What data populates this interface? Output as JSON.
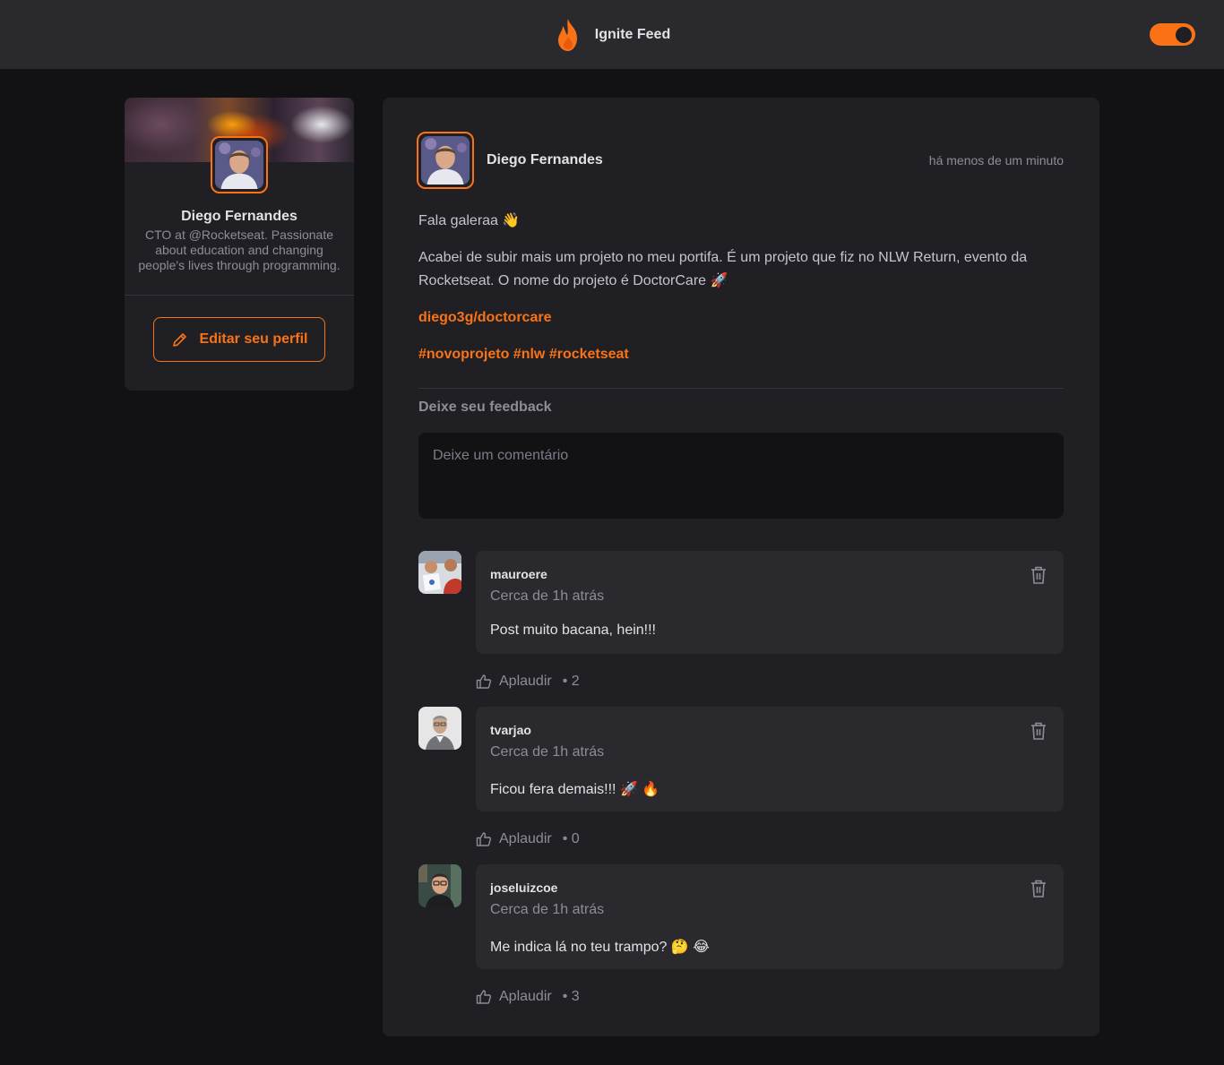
{
  "app": {
    "title": "Ignite Feed",
    "theme_toggle_on": true,
    "accent": "#f97316"
  },
  "profile": {
    "name": "Diego Fernandes",
    "role": "CTO at @Rocketseat. Passionate about education and changing people's lives through programming.",
    "edit_label": "Editar seu perfil"
  },
  "post": {
    "author": "Diego Fernandes",
    "time": "há menos de um minuto",
    "greeting": "Fala galeraa 👋",
    "body": "Acabei de subir mais um projeto no meu portifa. É um projeto que fiz no NLW Return, evento da Rocketseat. O nome do projeto é DoctorCare 🚀",
    "link": "diego3g/doctorcare",
    "tags": [
      "#novoprojeto",
      "#nlw",
      "#rocketseat"
    ],
    "feedback_title": "Deixe seu feedback",
    "comment_placeholder": "Deixe um comentário"
  },
  "comments": [
    {
      "author": "mauroere",
      "time": "Cerca de 1h atrás",
      "text": "Post muito bacana, hein!!!",
      "applaud_label": "Aplaudir",
      "count": "• 2"
    },
    {
      "author": "tvarjao",
      "time": "Cerca de 1h atrás",
      "text": "Ficou fera demais!!! 🚀 🔥",
      "applaud_label": "Aplaudir",
      "count": "• 0"
    },
    {
      "author": "joseluizcoe",
      "time": "Cerca de 1h atrás",
      "text": "Me indica lá no teu trampo? 🤔 😂",
      "applaud_label": "Aplaudir",
      "count": "• 3"
    }
  ]
}
